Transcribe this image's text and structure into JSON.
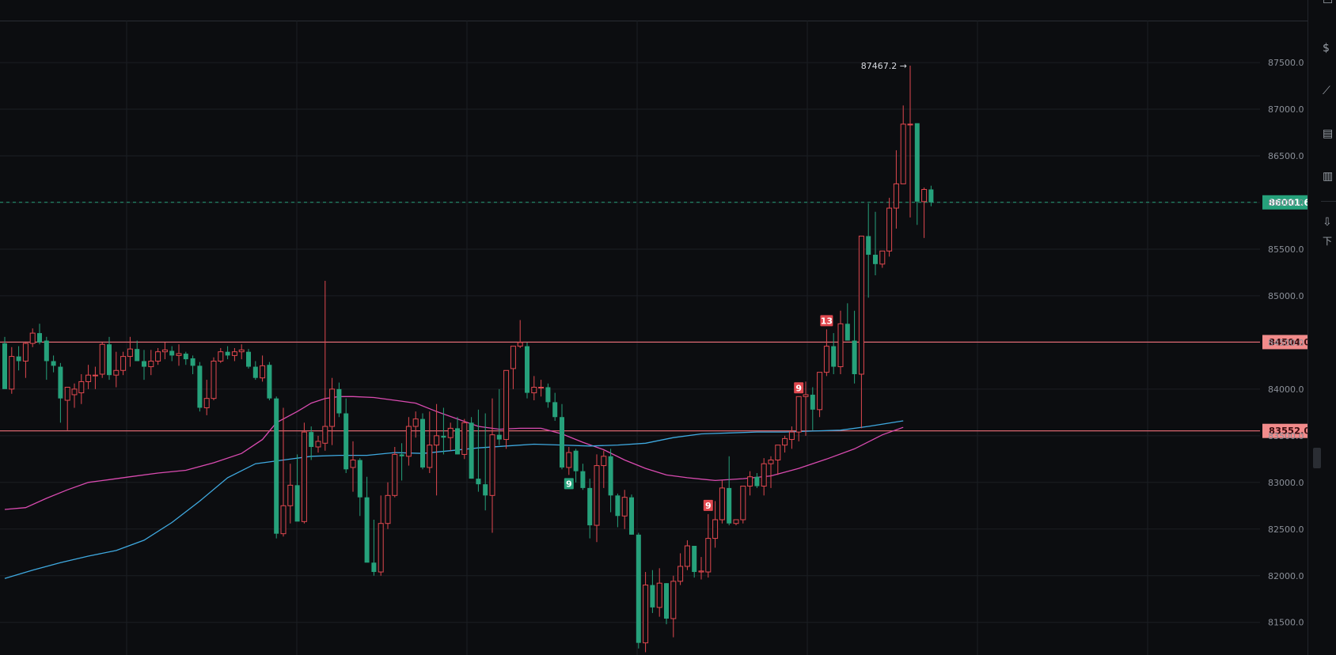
{
  "chart_data": {
    "type": "candlestick",
    "ylim": [
      81150,
      87950
    ],
    "y_ticks": [
      81500,
      82000,
      82500,
      83000,
      83500,
      84000,
      84500,
      85000,
      85500,
      86000,
      86500,
      87000,
      87500
    ],
    "tick_labels": [
      "81500.0",
      "82000.0",
      "82500.0",
      "83000.0",
      "83500.0",
      "84000.0",
      "84500.0",
      "85000.0",
      "85500.0",
      "86000.0",
      "86500.0",
      "87000.0",
      "87500.0"
    ],
    "current_price": {
      "value": 86001.6,
      "label": "86001.6"
    },
    "horizontal_lines": [
      {
        "value": 84504.0,
        "label": "84504.0"
      },
      {
        "value": 83552.0,
        "label": "83552.0"
      }
    ],
    "high_marker": {
      "value": 87467.2,
      "label": "87467.2 →"
    },
    "sequential_markers": [
      {
        "index": 81,
        "label": "9",
        "position": "below",
        "color": "#26a17b"
      },
      {
        "index": 101,
        "label": "9",
        "position": "above",
        "color": "#e0484f"
      },
      {
        "index": 114,
        "label": "9",
        "position": "above",
        "color": "#e0484f"
      },
      {
        "index": 118,
        "label": "13",
        "position": "above",
        "color": "#e0484f"
      }
    ],
    "ma_fast": [
      [
        0,
        82710
      ],
      [
        3,
        82730
      ],
      [
        6,
        82830
      ],
      [
        9,
        82920
      ],
      [
        12,
        83000
      ],
      [
        15,
        83030
      ],
      [
        18,
        83060
      ],
      [
        22,
        83100
      ],
      [
        26,
        83130
      ],
      [
        30,
        83210
      ],
      [
        34,
        83310
      ],
      [
        37,
        83460
      ],
      [
        39,
        83640
      ],
      [
        42,
        83760
      ],
      [
        44,
        83850
      ],
      [
        46,
        83900
      ],
      [
        48,
        83920
      ],
      [
        50,
        83920
      ],
      [
        53,
        83910
      ],
      [
        56,
        83880
      ],
      [
        59,
        83850
      ],
      [
        62,
        83760
      ],
      [
        65,
        83680
      ],
      [
        68,
        83600
      ],
      [
        71,
        83570
      ],
      [
        74,
        83580
      ],
      [
        77,
        83580
      ],
      [
        80,
        83520
      ],
      [
        83,
        83430
      ],
      [
        86,
        83350
      ],
      [
        89,
        83240
      ],
      [
        92,
        83150
      ],
      [
        95,
        83080
      ],
      [
        98,
        83050
      ],
      [
        102,
        83020
      ],
      [
        106,
        83040
      ],
      [
        110,
        83070
      ],
      [
        114,
        83150
      ],
      [
        118,
        83250
      ],
      [
        122,
        83360
      ],
      [
        126,
        83510
      ],
      [
        129,
        83590
      ]
    ],
    "ma_slow": [
      [
        0,
        81970
      ],
      [
        4,
        82060
      ],
      [
        8,
        82140
      ],
      [
        12,
        82210
      ],
      [
        16,
        82270
      ],
      [
        20,
        82380
      ],
      [
        24,
        82570
      ],
      [
        28,
        82800
      ],
      [
        32,
        83050
      ],
      [
        36,
        83200
      ],
      [
        40,
        83240
      ],
      [
        44,
        83280
      ],
      [
        48,
        83290
      ],
      [
        52,
        83290
      ],
      [
        56,
        83320
      ],
      [
        60,
        83310
      ],
      [
        64,
        83340
      ],
      [
        68,
        83370
      ],
      [
        72,
        83390
      ],
      [
        76,
        83410
      ],
      [
        80,
        83400
      ],
      [
        84,
        83390
      ],
      [
        88,
        83400
      ],
      [
        92,
        83420
      ],
      [
        96,
        83480
      ],
      [
        100,
        83520
      ],
      [
        104,
        83530
      ],
      [
        108,
        83540
      ],
      [
        112,
        83540
      ],
      [
        116,
        83550
      ],
      [
        120,
        83560
      ],
      [
        124,
        83600
      ],
      [
        129,
        83660
      ]
    ],
    "candles": [
      [
        84490,
        84560,
        84150,
        84000
      ],
      [
        84000,
        84450,
        83950,
        84350
      ],
      [
        84350,
        84460,
        84200,
        84300
      ],
      [
        84300,
        84510,
        84120,
        84490
      ],
      [
        84490,
        84650,
        84450,
        84600
      ],
      [
        84600,
        84700,
        84480,
        84500
      ],
      [
        84520,
        84560,
        84100,
        84300
      ],
      [
        84300,
        84360,
        84180,
        84250
      ],
      [
        84240,
        84280,
        83640,
        83900
      ],
      [
        83880,
        84020,
        83560,
        84020
      ],
      [
        83940,
        84060,
        83800,
        84000
      ],
      [
        83960,
        84160,
        83840,
        84080
      ],
      [
        84080,
        84260,
        84000,
        84150
      ],
      [
        84150,
        84240,
        84000,
        84150
      ],
      [
        84160,
        84500,
        84120,
        84480
      ],
      [
        84480,
        84560,
        84100,
        84150
      ],
      [
        84150,
        84400,
        84020,
        84200
      ],
      [
        84200,
        84400,
        84150,
        84350
      ],
      [
        84350,
        84560,
        84240,
        84430
      ],
      [
        84430,
        84520,
        84300,
        84300
      ],
      [
        84300,
        84420,
        84100,
        84240
      ],
      [
        84240,
        84420,
        84150,
        84300
      ],
      [
        84300,
        84440,
        84260,
        84400
      ],
      [
        84400,
        84500,
        84320,
        84420
      ],
      [
        84410,
        84460,
        84300,
        84360
      ],
      [
        84360,
        84480,
        84250,
        84380
      ],
      [
        84380,
        84400,
        84260,
        84320
      ],
      [
        84330,
        84360,
        84160,
        84250
      ],
      [
        84250,
        84290,
        83760,
        83800
      ],
      [
        83800,
        84100,
        83720,
        83900
      ],
      [
        83900,
        84340,
        83880,
        84300
      ],
      [
        84300,
        84440,
        84280,
        84400
      ],
      [
        84400,
        84460,
        84320,
        84360
      ],
      [
        84360,
        84440,
        84300,
        84400
      ],
      [
        84400,
        84480,
        84320,
        84420
      ],
      [
        84400,
        84430,
        84220,
        84240
      ],
      [
        84240,
        84300,
        84100,
        84120
      ],
      [
        84120,
        84360,
        84080,
        84250
      ],
      [
        84260,
        84290,
        83880,
        83900
      ],
      [
        83900,
        83920,
        82400,
        82450
      ],
      [
        82450,
        83800,
        82420,
        82750
      ],
      [
        82750,
        83200,
        82560,
        82970
      ],
      [
        82970,
        83300,
        82600,
        82580
      ],
      [
        82580,
        83640,
        82560,
        83540
      ],
      [
        83540,
        83600,
        83240,
        83380
      ],
      [
        83380,
        83500,
        83320,
        83440
      ],
      [
        83420,
        85160,
        83340,
        83600
      ],
      [
        83600,
        84120,
        83400,
        84000
      ],
      [
        84000,
        84070,
        83700,
        83740
      ],
      [
        83740,
        83900,
        83100,
        83140
      ],
      [
        83160,
        83440,
        82900,
        83240
      ],
      [
        83240,
        83260,
        82640,
        82840
      ],
      [
        82840,
        83060,
        82200,
        82140
      ],
      [
        82140,
        82600,
        82000,
        82040
      ],
      [
        82040,
        82860,
        82000,
        82560
      ],
      [
        82560,
        83000,
        82500,
        82860
      ],
      [
        82860,
        83380,
        82840,
        83300
      ],
      [
        83300,
        83420,
        83020,
        83280
      ],
      [
        83280,
        83700,
        83180,
        83600
      ],
      [
        83600,
        83760,
        83480,
        83680
      ],
      [
        83680,
        83740,
        83140,
        83160
      ],
      [
        83160,
        83760,
        83100,
        83400
      ],
      [
        83400,
        83840,
        82860,
        83500
      ],
      [
        83500,
        83800,
        83300,
        83480
      ],
      [
        83480,
        83640,
        83340,
        83580
      ],
      [
        83580,
        83700,
        83300,
        83300
      ],
      [
        83300,
        83680,
        83250,
        83640
      ],
      [
        83640,
        83700,
        83040,
        83040
      ],
      [
        83040,
        83780,
        82900,
        82980
      ],
      [
        82980,
        83740,
        82700,
        82860
      ],
      [
        82860,
        83900,
        82460,
        83510
      ],
      [
        83510,
        84000,
        83400,
        83460
      ],
      [
        83460,
        84080,
        83360,
        84200
      ],
      [
        84220,
        84460,
        84000,
        84460
      ],
      [
        84460,
        84740,
        84440,
        84500
      ],
      [
        84460,
        84500,
        83900,
        83960
      ],
      [
        83960,
        84140,
        83880,
        84020
      ],
      [
        84020,
        84100,
        83920,
        84020
      ],
      [
        84020,
        84060,
        83800,
        83860
      ],
      [
        83860,
        83960,
        83660,
        83700
      ],
      [
        83700,
        83840,
        83140,
        83160
      ],
      [
        83160,
        83380,
        83080,
        83320
      ],
      [
        83340,
        83360,
        83000,
        83120
      ],
      [
        83120,
        83200,
        82920,
        82940
      ],
      [
        82940,
        83040,
        82400,
        82540
      ],
      [
        82540,
        83300,
        82360,
        83180
      ],
      [
        83180,
        83340,
        82940,
        83280
      ],
      [
        83280,
        83360,
        82680,
        82860
      ],
      [
        82860,
        82880,
        82520,
        82640
      ],
      [
        82640,
        82920,
        82500,
        82840
      ],
      [
        82840,
        82870,
        82440,
        82440
      ],
      [
        82440,
        82460,
        81220,
        81280
      ],
      [
        81280,
        82040,
        81180,
        81900
      ],
      [
        81900,
        82060,
        81600,
        81660
      ],
      [
        81660,
        82080,
        81560,
        81920
      ],
      [
        81920,
        81920,
        81480,
        81540
      ],
      [
        81540,
        82000,
        81340,
        81940
      ],
      [
        81940,
        82240,
        81900,
        82100
      ],
      [
        82100,
        82380,
        82060,
        82320
      ],
      [
        82320,
        82300,
        81980,
        82040
      ],
      [
        82040,
        82200,
        81960,
        82050
      ],
      [
        82040,
        82660,
        81980,
        82400
      ],
      [
        82400,
        82800,
        82300,
        82600
      ],
      [
        82600,
        83020,
        82560,
        82940
      ],
      [
        82940,
        83280,
        82540,
        82560
      ],
      [
        82560,
        82580,
        82540,
        82600
      ],
      [
        82600,
        82940,
        82560,
        82960
      ],
      [
        82960,
        83120,
        82860,
        83060
      ],
      [
        83060,
        83100,
        82940,
        82960
      ],
      [
        82960,
        83260,
        82860,
        83200
      ],
      [
        83200,
        83280,
        82940,
        83240
      ],
      [
        83240,
        83400,
        83080,
        83400
      ],
      [
        83400,
        83500,
        83320,
        83470
      ],
      [
        83460,
        83600,
        83360,
        83540
      ],
      [
        83540,
        83920,
        83440,
        83920
      ],
      [
        83920,
        84080,
        83500,
        83940
      ],
      [
        83940,
        84020,
        83560,
        83780
      ],
      [
        83780,
        84160,
        83700,
        84180
      ],
      [
        84180,
        84640,
        84140,
        84460
      ],
      [
        84460,
        84600,
        84160,
        84240
      ],
      [
        84240,
        84840,
        84160,
        84700
      ],
      [
        84700,
        84920,
        84640,
        84520
      ],
      [
        84520,
        84840,
        84060,
        84160
      ],
      [
        84160,
        85400,
        83580,
        85640
      ],
      [
        85640,
        85990,
        84980,
        85440
      ],
      [
        85440,
        85900,
        85220,
        85340
      ],
      [
        85340,
        85440,
        85300,
        85480
      ],
      [
        85480,
        86050,
        85420,
        85940
      ],
      [
        85940,
        86560,
        85720,
        86200
      ],
      [
        86200,
        87040,
        86300,
        86840
      ],
      [
        86840,
        87467.2,
        85840,
        86840
      ],
      [
        86850,
        86380,
        85760,
        86010
      ],
      [
        86010,
        86160,
        85620,
        86140
      ],
      [
        86140,
        86180,
        85960,
        86001.6
      ]
    ]
  },
  "sidebar": {
    "icons": [
      "calendar-icon",
      "dollar-doc-icon",
      "trend-chart-icon",
      "monitor-chart-icon",
      "etf-doc-icon",
      "download-icon"
    ],
    "label": "下"
  },
  "colors": {
    "up": "#e0484f",
    "down": "#26a17b",
    "ma_fast": "#d94bb0",
    "ma_slow": "#3fa9e0",
    "line": "#f0707a",
    "line_label_bg": "#f28b8b",
    "current_bg": "#26a17b"
  }
}
